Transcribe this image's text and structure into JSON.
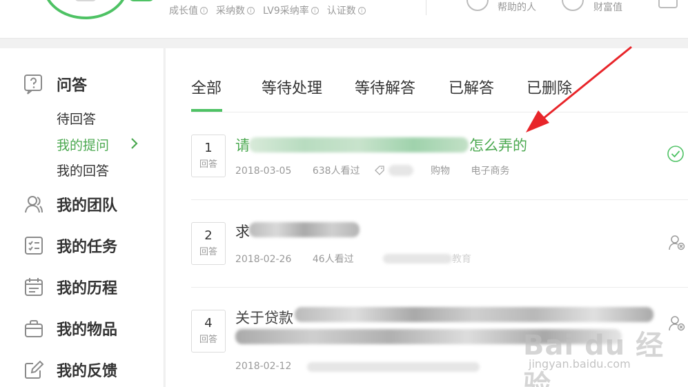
{
  "header": {
    "stats": [
      {
        "label": "成长值"
      },
      {
        "label": "采纳数"
      },
      {
        "label": "LV9采纳率"
      },
      {
        "label": "认证数"
      }
    ],
    "right_items": [
      {
        "label": "帮助的人"
      },
      {
        "label": "财富值"
      }
    ]
  },
  "sidebar": {
    "sections": [
      {
        "title": "问答",
        "icon": "question-icon"
      },
      {
        "title": "我的团队",
        "icon": "team-icon"
      },
      {
        "title": "我的任务",
        "icon": "task-list-icon"
      },
      {
        "title": "我的历程",
        "icon": "calendar-icon"
      },
      {
        "title": "我的物品",
        "icon": "bag-icon"
      },
      {
        "title": "我的反馈",
        "icon": "edit-icon"
      }
    ],
    "qa_items": [
      {
        "label": "待回答",
        "active": false
      },
      {
        "label": "我的提问",
        "active": true
      },
      {
        "label": "我的回答",
        "active": false
      }
    ]
  },
  "tabs": [
    {
      "label": "全部",
      "active": true
    },
    {
      "label": "等待处理",
      "active": false
    },
    {
      "label": "等待解答",
      "active": false
    },
    {
      "label": "已解答",
      "active": false
    },
    {
      "label": "已删除",
      "active": false
    }
  ],
  "questions": [
    {
      "count": "1",
      "count_label": "回答",
      "title_start": "请",
      "title_end": "怎么弄的",
      "date": "2018-03-05",
      "views": "638人看过",
      "tags": [
        "购物",
        "电子商务"
      ],
      "status_icon": "check-circle-icon"
    },
    {
      "count": "2",
      "count_label": "回答",
      "title_start": "求",
      "date": "2018-02-26",
      "views": "46人看过",
      "tag_partial": "教育",
      "status_icon": "user-remove-icon"
    },
    {
      "count": "4",
      "count_label": "回答",
      "title_start": "关于贷款",
      "date": "2018-02-12",
      "status_icon": "user-remove-icon"
    }
  ],
  "watermark": {
    "logo": "Bai du 经验",
    "url": "jingyan.baidu.com"
  },
  "colors": {
    "accent": "#4ec264",
    "accent_text": "#4aa84f",
    "arrow": "#e8252a"
  }
}
